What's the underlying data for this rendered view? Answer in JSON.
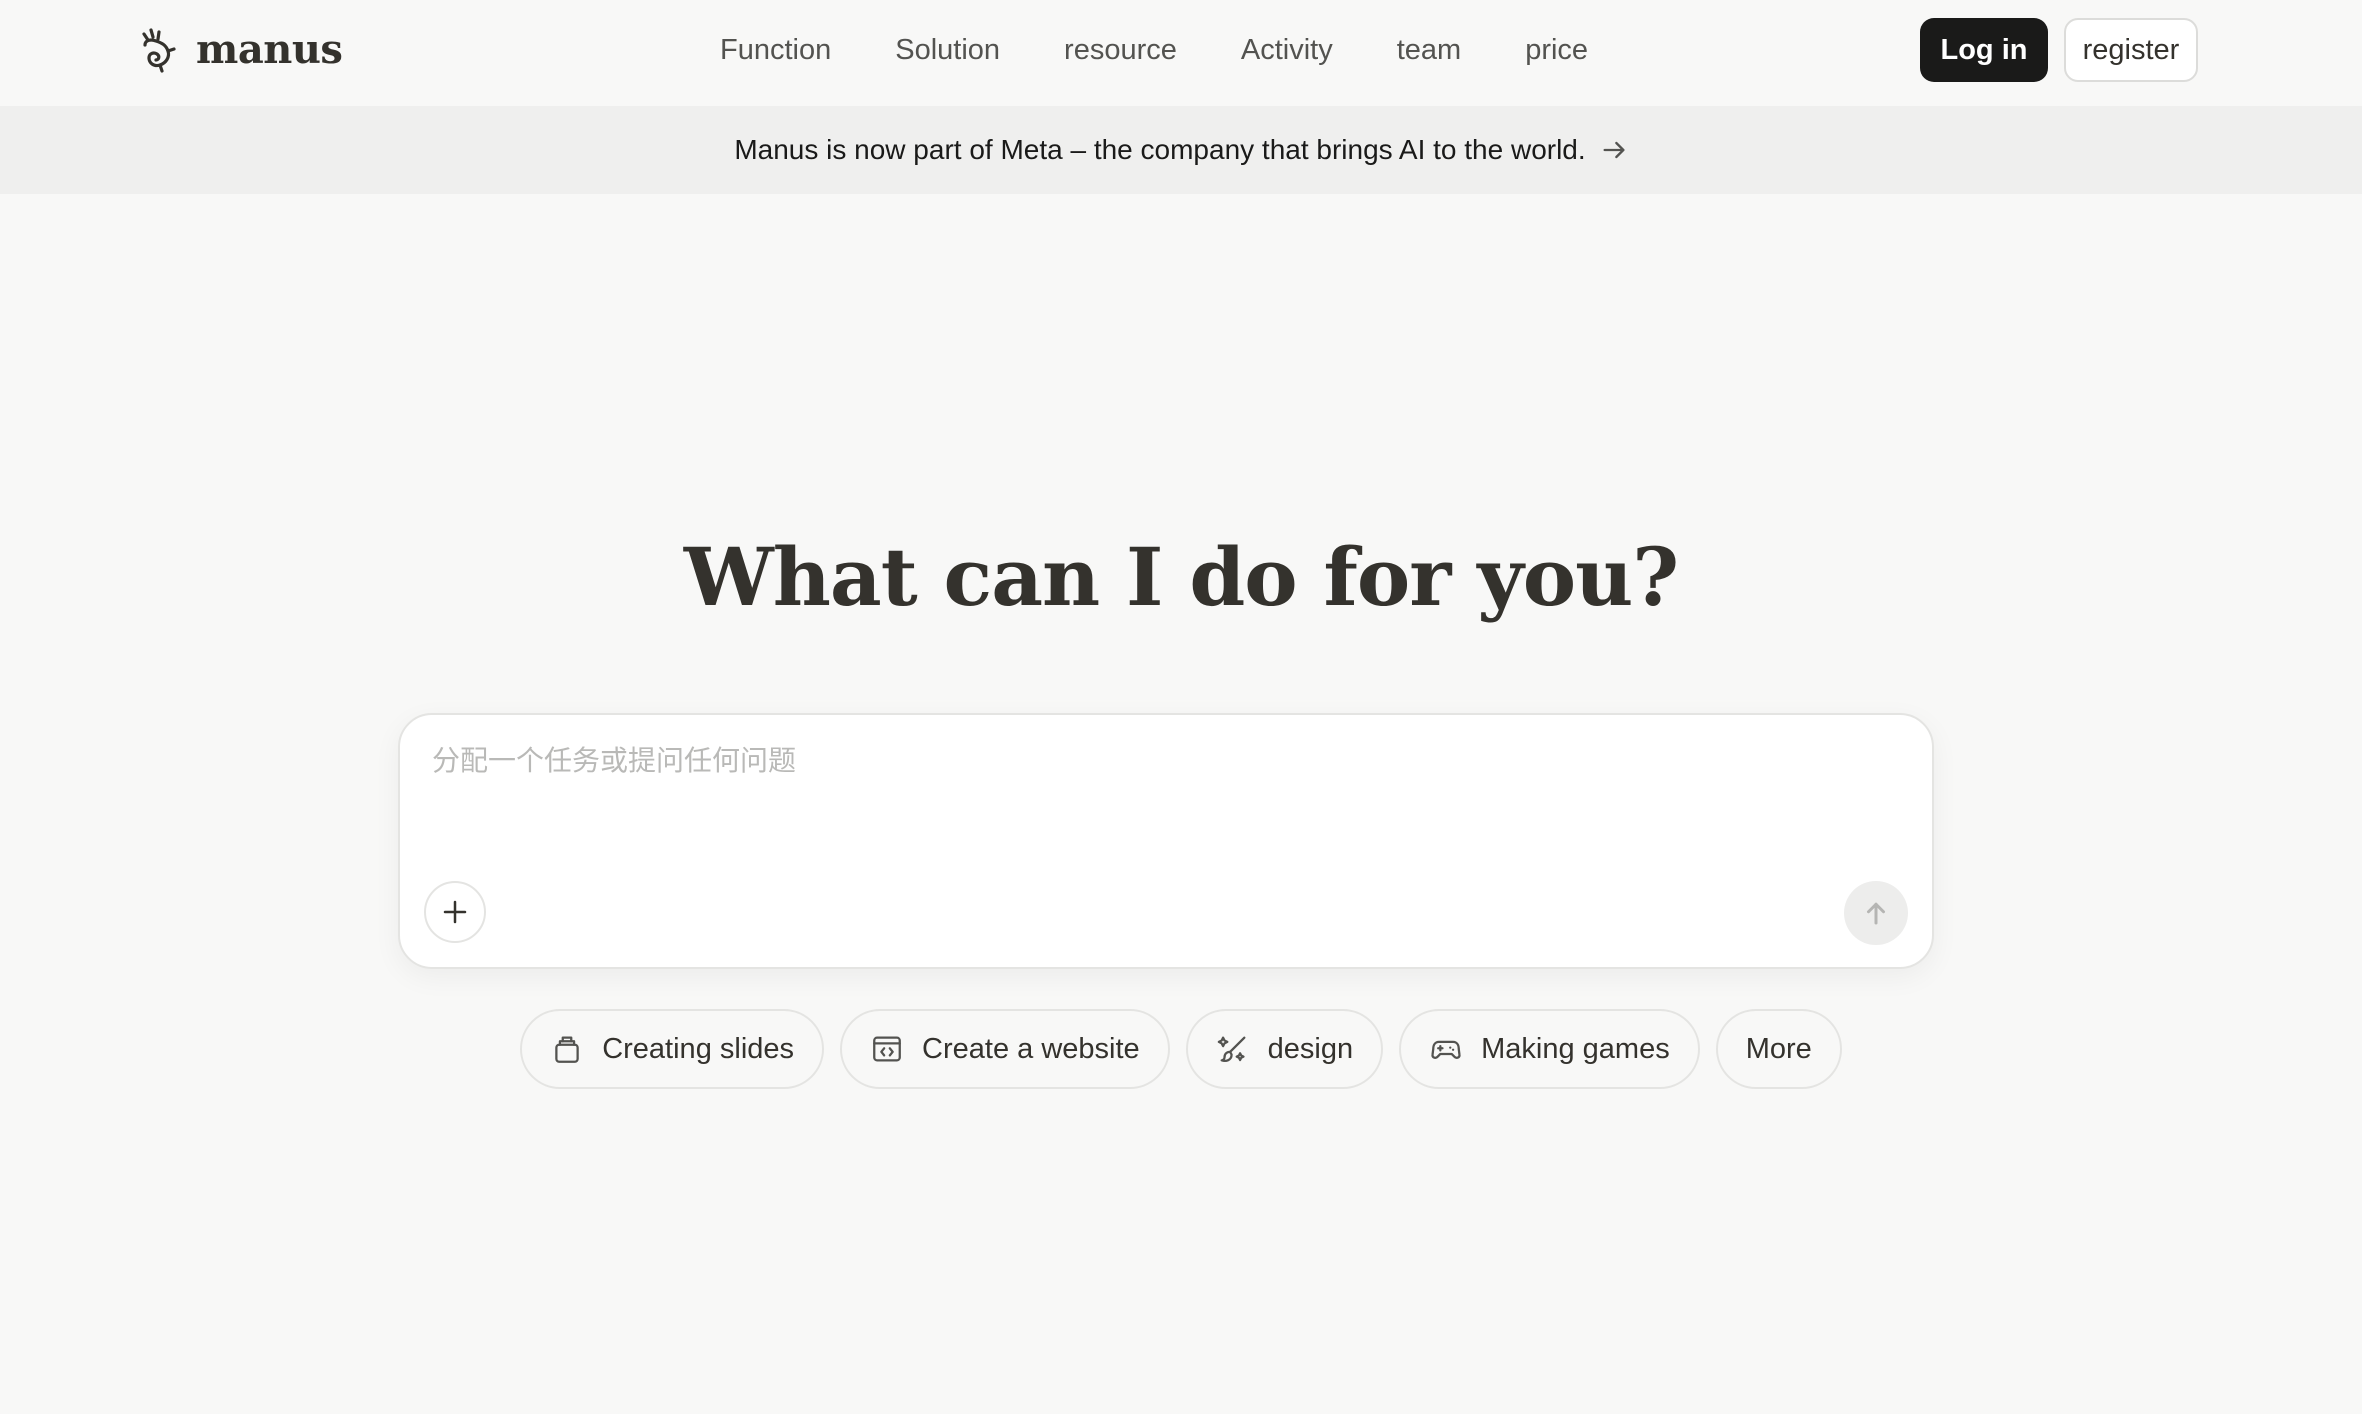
{
  "brand": {
    "name": "manus",
    "logo_icon": "manus-hand-logo-icon"
  },
  "nav": {
    "links": [
      "Function",
      "Solution",
      "resource",
      "Activity",
      "team",
      "price"
    ],
    "login_label": "Log in",
    "register_label": "register"
  },
  "announcement": {
    "text": "Manus is now part of Meta – the company that brings AI to the world.",
    "icon": "arrow-right-icon"
  },
  "hero": {
    "title": "What can I do for you?"
  },
  "composer": {
    "placeholder": "分配一个任务或提问任何问题",
    "value": "",
    "attach_icon": "plus-icon",
    "send_icon": "arrow-up-icon"
  },
  "quick_actions": [
    {
      "label": "Creating slides",
      "icon": "slides-icon"
    },
    {
      "label": "Create a website",
      "icon": "website-code-icon"
    },
    {
      "label": "design",
      "icon": "design-brush-icon"
    },
    {
      "label": "Making games",
      "icon": "gamepad-icon"
    },
    {
      "label": "More",
      "icon": ""
    }
  ],
  "colors": {
    "background": "#f8f8f7",
    "banner": "#efefee",
    "primary_button": "#1a1a19",
    "text": "#34322d"
  }
}
